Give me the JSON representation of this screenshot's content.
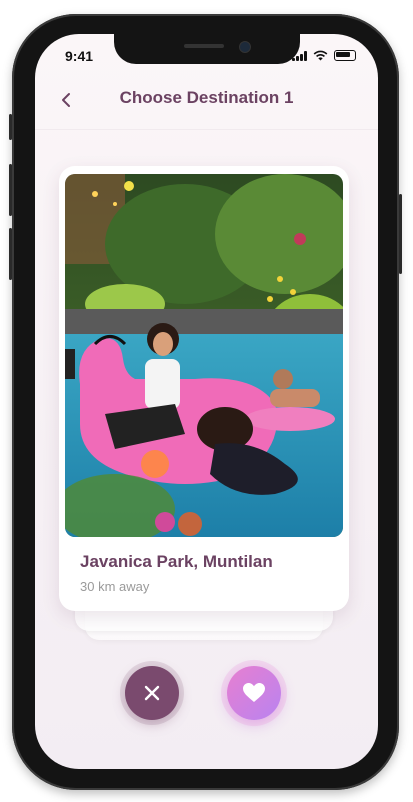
{
  "status_bar": {
    "time": "9:41"
  },
  "header": {
    "title": "Choose Destination 1"
  },
  "destination": {
    "name": "Javanica Park, Muntilan",
    "distance": "30 km away"
  },
  "actions": {
    "reject_icon": "close-icon",
    "like_icon": "heart-icon"
  },
  "colors": {
    "primary": "#6b4262",
    "reject_button": "#7a4a6e",
    "like_gradient_start": "#e77fd0",
    "like_gradient_end": "#b983f0",
    "secondary_text": "#9a9a9a"
  }
}
